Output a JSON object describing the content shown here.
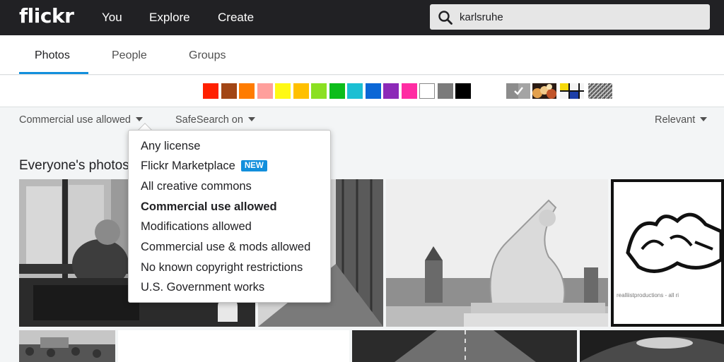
{
  "header": {
    "logo": "flickr",
    "nav": [
      "You",
      "Explore",
      "Create"
    ],
    "search_value": "karlsruhe"
  },
  "tabs": [
    "Photos",
    "People",
    "Groups"
  ],
  "active_tab": "Photos",
  "color_swatches": [
    "#ff2000",
    "#a24615",
    "#ff7c00",
    "#ff9f9c",
    "#fff914",
    "#ffc000",
    "#8be022",
    "#0dbd1b",
    "#1bbfd3",
    "#0b67d6",
    "#8c2ab8",
    "#ff2ca3",
    "#ffffff",
    "#7b7b7b",
    "#000000"
  ],
  "style_swatches": [
    "black-and-white",
    "shallow-depth-of-field",
    "minimalist",
    "patterns"
  ],
  "filters": {
    "license": "Commercial use allowed",
    "safesearch": "SafeSearch on",
    "sort": "Relevant"
  },
  "section_heading": "Everyone's photos",
  "license_menu": {
    "options": [
      {
        "label": "Any license"
      },
      {
        "label": "Flickr Marketplace",
        "badge": "NEW"
      },
      {
        "label": "All creative commons"
      },
      {
        "label": "Commercial use allowed"
      },
      {
        "label": "Modifications allowed"
      },
      {
        "label": "Commercial use & mods allowed"
      },
      {
        "label": "No known copyright restrictions"
      },
      {
        "label": "U.S. Government works"
      }
    ],
    "selected": "Commercial use allowed"
  },
  "photo_watermark": "realliistproductions - all ri"
}
